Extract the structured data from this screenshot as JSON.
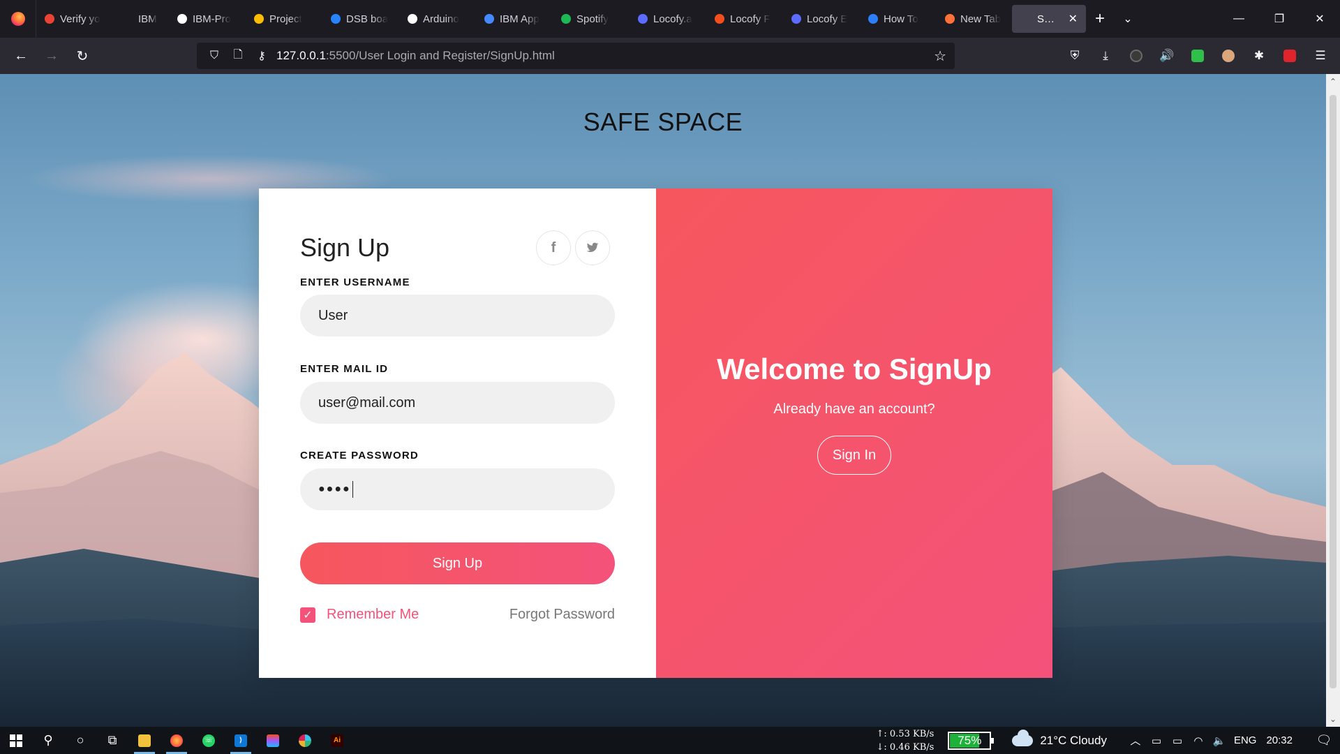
{
  "browser": {
    "tabs": [
      {
        "title": "Verify yo",
        "favicon": "gmail-icon",
        "color": "#ea4335"
      },
      {
        "title": "IBM",
        "favicon": "ibm-icon",
        "color": "#1c1b22"
      },
      {
        "title": "IBM-Pro",
        "favicon": "github-icon",
        "color": "#ffffff"
      },
      {
        "title": "Project",
        "favicon": "google-drive-icon",
        "color": "#fbbc04"
      },
      {
        "title": "DSB boa",
        "favicon": "jira-icon",
        "color": "#2684ff"
      },
      {
        "title": "Arduino",
        "favicon": "wordpress-w-icon",
        "color": "#ffffff"
      },
      {
        "title": "IBM App",
        "favicon": "ibm-cloud-icon",
        "color": "#4589ff"
      },
      {
        "title": "Spotify",
        "favicon": "spotify-icon",
        "color": "#1db954"
      },
      {
        "title": "Locofy.a",
        "favicon": "locofy-icon",
        "color": "#5b6cff"
      },
      {
        "title": "Locofy F",
        "favicon": "figma-icon",
        "color": "#f24e1e"
      },
      {
        "title": "Locofy E",
        "favicon": "locofy-icon",
        "color": "#5b6cff"
      },
      {
        "title": "How To",
        "favicon": "howto-icon",
        "color": "#2d7ff9"
      },
      {
        "title": "New Tab",
        "favicon": "firefox-icon",
        "color": "#ff7139"
      },
      {
        "title": "SAFE SPAC",
        "favicon": "page-icon",
        "color": "#42414d",
        "active": true
      }
    ],
    "url_host": "127.0.0.1",
    "url_rest": ":5500/User Login and Register/SignUp.html"
  },
  "page": {
    "site_title": "SAFE SPACE",
    "form": {
      "title": "Sign Up",
      "facebook_glyph": "f",
      "twitter_glyph": "🐦",
      "username_label": "ENTER USERNAME",
      "username_value": "User",
      "email_label": "ENTER MAIL ID",
      "email_value": "user@mail.com",
      "password_label": "CREATE PASSWORD",
      "password_value": "●●●●",
      "submit_label": "Sign Up",
      "remember_label": "Remember Me",
      "remember_checked": true,
      "forgot_label": "Forgot Password"
    },
    "welcome": {
      "heading": "Welcome to SignUp",
      "subtext": "Already have an account?",
      "signin_label": "Sign In"
    },
    "colors": {
      "accent_start": "#f6575d",
      "accent_end": "#f4527a"
    }
  },
  "taskbar": {
    "upload": "↑: 0.53 KB/s",
    "download": "↓: 0.46 KB/s",
    "battery": "75%",
    "battery_level": 0.75,
    "weather": "21°C  Cloudy",
    "language": "ENG",
    "time": "20:32"
  }
}
